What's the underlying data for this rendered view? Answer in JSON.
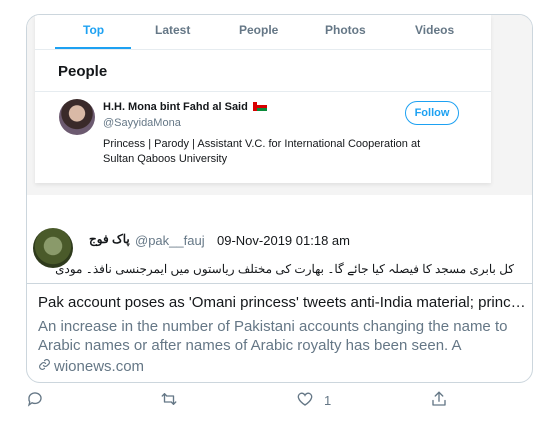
{
  "screenshot": {
    "tabs": [
      "Top",
      "Latest",
      "People",
      "Photos",
      "Videos"
    ],
    "people_heading": "People",
    "profile": {
      "name": "H.H. Mona bint Fahd al Said",
      "handle": "@SayyidaMona",
      "bio": "Princess | Parody | Assistant V.C. for International Cooperation at Sultan Qaboos University",
      "follow_label": "Follow"
    },
    "tweet": {
      "name": "پاک فوج",
      "handle": "@pak__fauj",
      "date": "09-Nov-2019 01:18 am",
      "text": "کل بابری مسجد کا فیصلہ کیا جائے گا۔ بھارت کی مختلف ریاستوں میں ایمرجنسی نافذ۔ مودی"
    }
  },
  "card": {
    "title": "Pak account poses as 'Omani princess' tweets anti-India material; prince...",
    "description": "An increase in the number of Pakistani accounts changing the name to Arabic names or after names of Arabic royalty has been seen. A Pakistan...",
    "domain": "wionews.com"
  },
  "actions": {
    "like_count": "1"
  },
  "colors": {
    "accent": "#1da1f2",
    "muted": "#657786",
    "border": "#ccd6dd"
  }
}
